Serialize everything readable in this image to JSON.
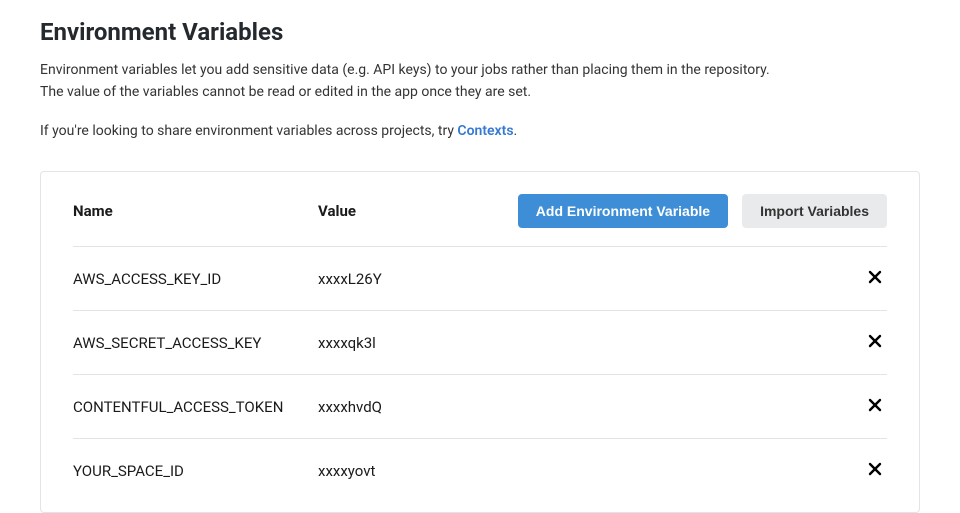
{
  "header": {
    "title": "Environment Variables",
    "description_prefix": "Environment variables let you add sensitive data (e.g. API keys) to your jobs rather than placing them in the repository. The value of the variables cannot be read or edited in the app once they are set.",
    "contexts_prefix": "If you're looking to share environment variables across projects, try ",
    "contexts_link": "Contexts",
    "contexts_suffix": "."
  },
  "table": {
    "headers": {
      "name": "Name",
      "value": "Value"
    },
    "buttons": {
      "add": "Add Environment Variable",
      "import": "Import Variables"
    },
    "rows": [
      {
        "name": "AWS_ACCESS_KEY_ID",
        "value": "xxxxL26Y"
      },
      {
        "name": "AWS_SECRET_ACCESS_KEY",
        "value": "xxxxqk3l"
      },
      {
        "name": "CONTENTFUL_ACCESS_TOKEN",
        "value": "xxxxhvdQ"
      },
      {
        "name": "YOUR_SPACE_ID",
        "value": "xxxxyovt"
      }
    ]
  }
}
